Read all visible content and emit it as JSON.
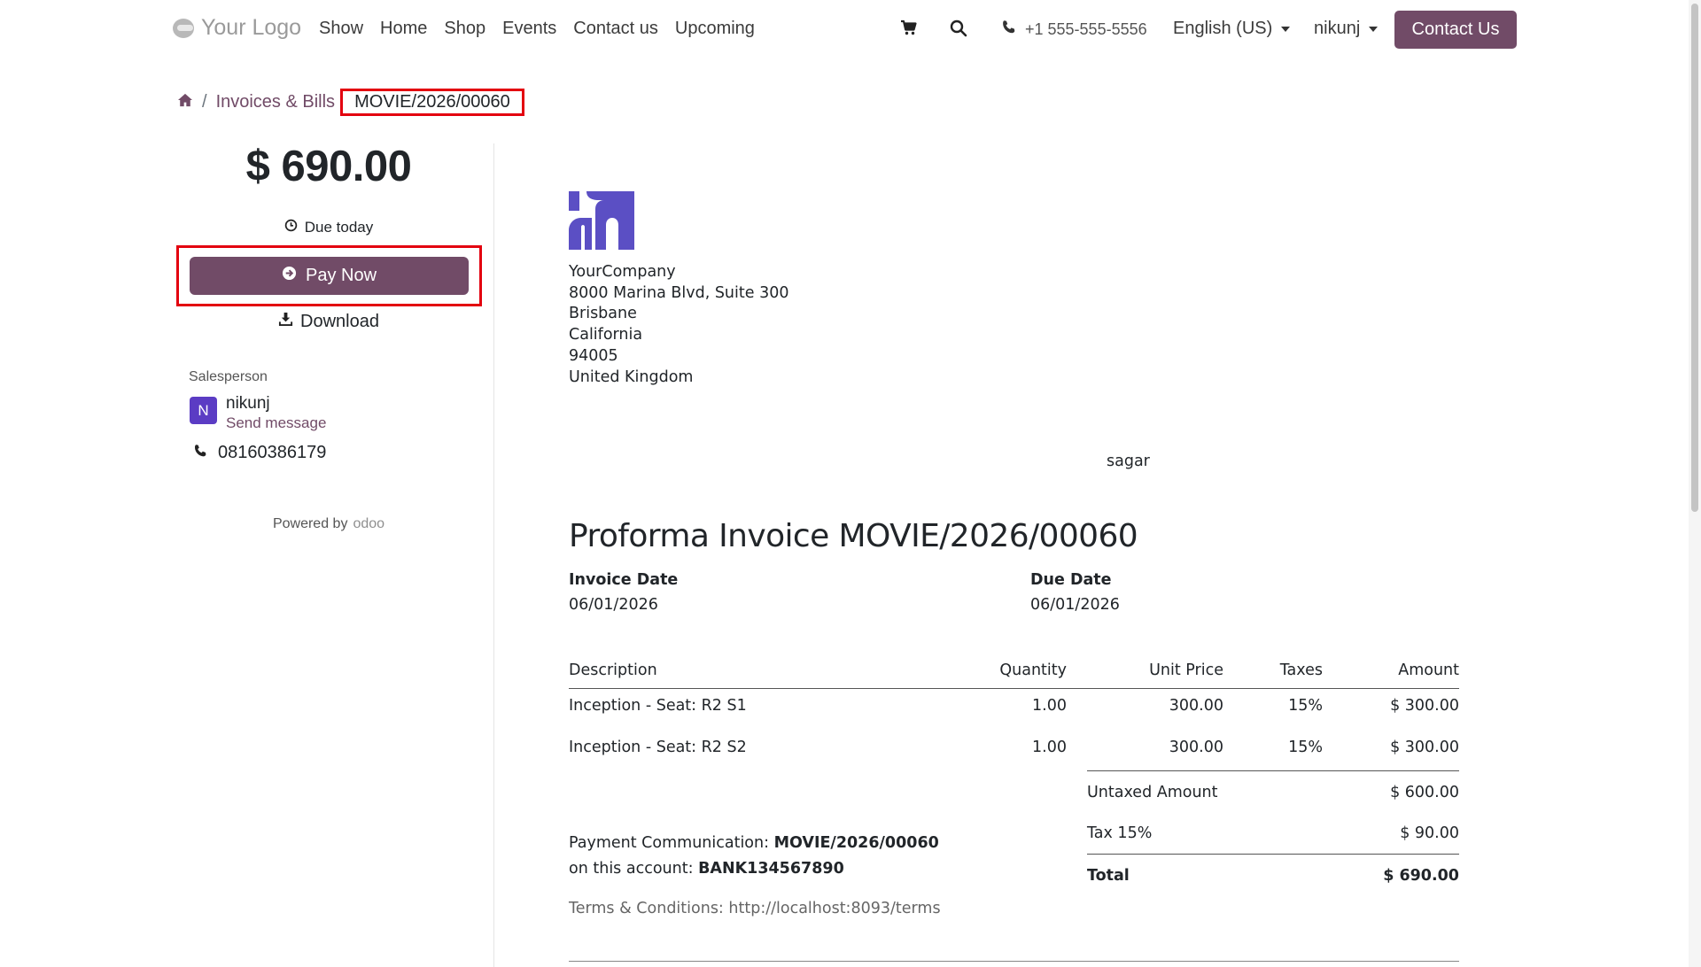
{
  "header": {
    "logo_text": "Your Logo",
    "nav": [
      "Show",
      "Home",
      "Shop",
      "Events",
      "Contact us",
      "Upcoming"
    ],
    "phone": "+1 555-555-5556",
    "language": "English (US)",
    "user": "nikunj",
    "contact_button": "Contact Us",
    "icons": [
      "cart-icon",
      "search-icon",
      "phone-icon"
    ]
  },
  "breadcrumb": {
    "home_icon": "home-icon",
    "separator": "/",
    "invoices": "Invoices & Bills",
    "current": "MOVIE/2026/00060"
  },
  "sidebar": {
    "amount": "$ 690.00",
    "due": "Due today",
    "pay_now": "Pay Now",
    "download": "Download",
    "salesperson_label": "Salesperson",
    "avatar_initial": "N",
    "salesperson_name": "nikunj",
    "send_message": "Send message",
    "phone": "08160386179",
    "powered_by": "Powered by",
    "powered_brand": "odoo"
  },
  "invoice": {
    "company_name": "YourCompany",
    "address_lines": [
      "8000 Marina Blvd, Suite 300",
      "Brisbane",
      "California",
      "94005",
      "United Kingdom"
    ],
    "partner": "sagar",
    "title": "Proforma Invoice MOVIE/2026/00060",
    "invoice_date_label": "Invoice Date",
    "invoice_date": "06/01/2026",
    "due_date_label": "Due Date",
    "due_date": "06/01/2026",
    "columns": [
      "Description",
      "Quantity",
      "Unit Price",
      "Taxes",
      "Amount"
    ],
    "lines": [
      {
        "description": "Inception - Seat: R2 S1",
        "quantity": "1.00",
        "unit_price": "300.00",
        "taxes": "15%",
        "amount": "$ 300.00"
      },
      {
        "description": "Inception - Seat: R2 S2",
        "quantity": "1.00",
        "unit_price": "300.00",
        "taxes": "15%",
        "amount": "$ 300.00"
      }
    ],
    "untaxed_label": "Untaxed Amount",
    "untaxed_value": "$ 600.00",
    "tax_label": "Tax 15%",
    "tax_value": "$ 90.00",
    "total_label": "Total",
    "total_value": "$ 690.00",
    "payment_comm_label": "Payment Communication:",
    "payment_comm_value": "MOVIE/2026/00060",
    "account_label": "on this account:",
    "account_value": "BANK134567890",
    "terms": "Terms & Conditions: http://localhost:8093/terms"
  },
  "colors": {
    "brand": "#714b67",
    "highlight": "#e3000f",
    "avatar": "#5b3cc4",
    "company_logo": "#5b4fc4"
  }
}
